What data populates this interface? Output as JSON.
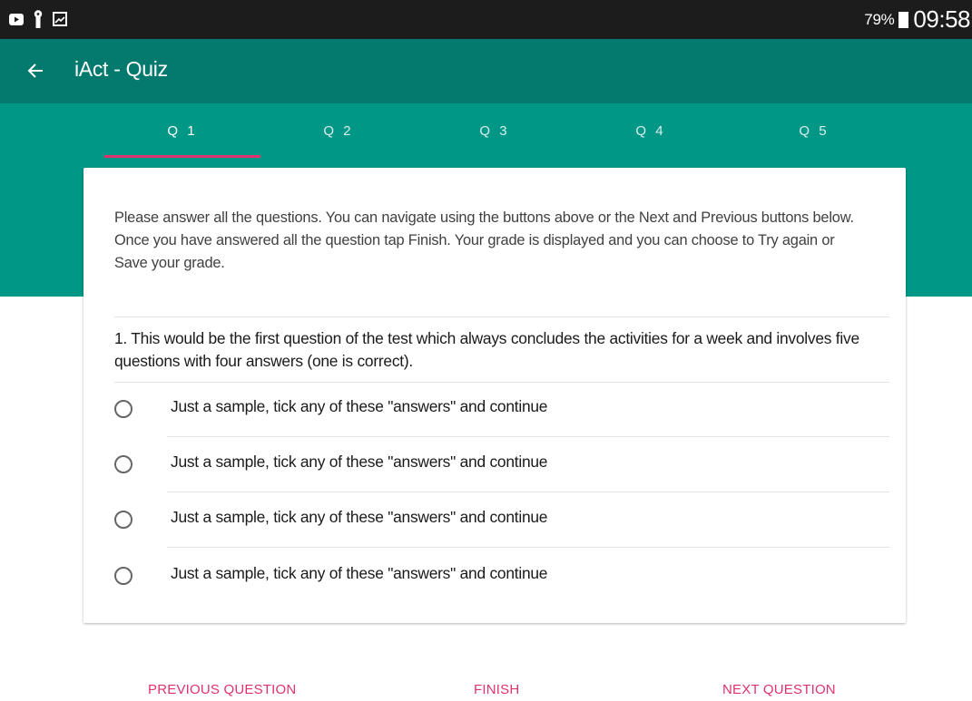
{
  "status_bar": {
    "icons": [
      "video-icon",
      "key-icon",
      "image-icon"
    ],
    "battery": "79%",
    "time": "09:58"
  },
  "app_bar": {
    "back_icon": "arrow-left-icon",
    "title": "iAct - Quiz"
  },
  "tabs": [
    {
      "label": "Q 1",
      "selected": true
    },
    {
      "label": "Q 2",
      "selected": false
    },
    {
      "label": "Q 3",
      "selected": false
    },
    {
      "label": "Q 4",
      "selected": false
    },
    {
      "label": "Q 5",
      "selected": false
    }
  ],
  "card": {
    "instructions": "Please answer all the questions. You can navigate using the buttons above or the Next and Previous buttons below. Once you have answered all the question tap Finish. Your grade is displayed and you can choose to Try again or Save your grade.",
    "question": "1. This would be the first question of the test which always concludes the activities for a week and involves five questions with four answers (one is correct).",
    "answers": [
      {
        "label": "Just a sample, tick any of these \"answers\" and continue",
        "checked": false
      },
      {
        "label": "Just a sample, tick any of these \"answers\" and continue",
        "checked": false
      },
      {
        "label": "Just a sample, tick any of these \"answers\" and continue",
        "checked": false
      },
      {
        "label": "Just a sample, tick any of these \"answers\" and continue",
        "checked": false
      }
    ]
  },
  "buttons": {
    "previous": "PREVIOUS QUESTION",
    "finish": "FINISH",
    "next": "NEXT QUESTION"
  },
  "colors": {
    "status_bar": "#1c1c1c",
    "app_bar": "#047a6f",
    "tab_band": "#009787",
    "accent": "#e0326e"
  }
}
